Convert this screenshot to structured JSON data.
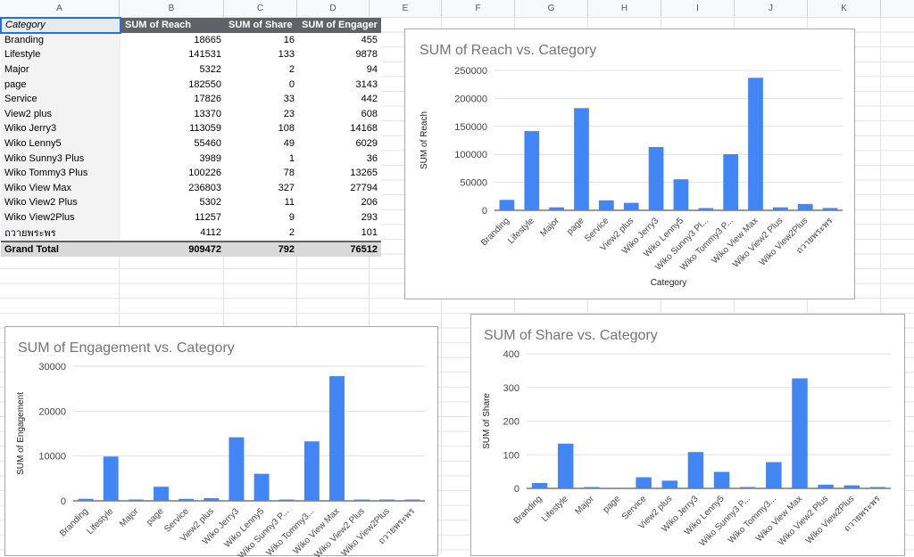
{
  "columns": [
    "A",
    "B",
    "C",
    "D",
    "E",
    "F",
    "G",
    "H",
    "I",
    "J",
    "K"
  ],
  "table": {
    "headers": [
      "Category",
      "SUM of Reach",
      "SUM of Share",
      "SUM of Engager"
    ],
    "rows": [
      {
        "category": "Branding",
        "reach": "18665",
        "share": "16",
        "engagement": "455"
      },
      {
        "category": "Lifestyle",
        "reach": "141531",
        "share": "133",
        "engagement": "9878"
      },
      {
        "category": "Major",
        "reach": "5322",
        "share": "2",
        "engagement": "94"
      },
      {
        "category": "page",
        "reach": "182550",
        "share": "0",
        "engagement": "3143"
      },
      {
        "category": "Service",
        "reach": "17826",
        "share": "33",
        "engagement": "442"
      },
      {
        "category": "View2 plus",
        "reach": "13370",
        "share": "23",
        "engagement": "608"
      },
      {
        "category": "Wiko Jerry3",
        "reach": "113059",
        "share": "108",
        "engagement": "14168"
      },
      {
        "category": "Wiko Lenny5",
        "reach": "55460",
        "share": "49",
        "engagement": "6029"
      },
      {
        "category": "Wiko Sunny3 Plus",
        "reach": "3989",
        "share": "1",
        "engagement": "36"
      },
      {
        "category": "Wiko Tommy3 Plus",
        "reach": "100226",
        "share": "78",
        "engagement": "13265"
      },
      {
        "category": "Wiko View Max",
        "reach": "236803",
        "share": "327",
        "engagement": "27794"
      },
      {
        "category": "Wiko View2 Plus",
        "reach": "5302",
        "share": "11",
        "engagement": "206"
      },
      {
        "category": "Wiko View2Plus",
        "reach": "11257",
        "share": "9",
        "engagement": "293"
      },
      {
        "category": "ถวายพระพร",
        "reach": "4112",
        "share": "2",
        "engagement": "101"
      }
    ],
    "total": {
      "category": "Grand Total",
      "reach": "909472",
      "share": "792",
      "engagement": "76512"
    }
  },
  "chart_data": [
    {
      "type": "bar",
      "title": "SUM of Reach vs. Category",
      "xlabel": "Category",
      "ylabel": "SUM of Reach",
      "ylim": [
        0,
        250000
      ],
      "yticks": [
        "0",
        "50000",
        "100000",
        "150000",
        "200000",
        "250000"
      ],
      "categories": [
        "Branding",
        "Lifestyle",
        "Major",
        "page",
        "Service",
        "View2 plus",
        "Wiko Jerry3",
        "Wiko Lenny5",
        "Wiko Sunny3 Pl...",
        "Wiko Tommy3 P...",
        "Wiko View Max",
        "Wiko View2 Plus",
        "Wiko View2Plus",
        "ถวายพระพร"
      ],
      "values": [
        18665,
        141531,
        5322,
        182550,
        17826,
        13370,
        113059,
        55460,
        3989,
        100226,
        236803,
        5302,
        11257,
        4112
      ],
      "color": "#4285f4",
      "grid": true
    },
    {
      "type": "bar",
      "title": "SUM of Engagement vs. Category",
      "xlabel": "",
      "ylabel": "SUM of Engagement",
      "ylim": [
        0,
        30000
      ],
      "yticks": [
        "0",
        "10000",
        "20000",
        "30000"
      ],
      "categories": [
        "Branding",
        "Lifestyle",
        "Major",
        "page",
        "Service",
        "View2 plus",
        "Wiko Jerry3",
        "Wiko Lenny5",
        "Wiko Sunny3 P...",
        "Wiko Tommy3...",
        "Wiko View Max",
        "Wiko View2 Plus",
        "Wiko View2Plus",
        "ถวายพระพร"
      ],
      "values": [
        455,
        9878,
        94,
        3143,
        442,
        608,
        14168,
        6029,
        36,
        13265,
        27794,
        206,
        293,
        101
      ],
      "color": "#4285f4",
      "grid": true
    },
    {
      "type": "bar",
      "title": "SUM of Share vs. Category",
      "xlabel": "",
      "ylabel": "SUM of Share",
      "ylim": [
        0,
        400
      ],
      "yticks": [
        "0",
        "100",
        "200",
        "300",
        "400"
      ],
      "categories": [
        "Branding",
        "Lifestyle",
        "Major",
        "page",
        "Service",
        "View2 plus",
        "Wiko Jerry3",
        "Wiko Lenny5",
        "Wiko Sunny3 P...",
        "Wiko Tommy3...",
        "Wiko View Max",
        "Wiko View2 Plus",
        "Wiko View2Plus",
        "ถวายพระพร"
      ],
      "values": [
        16,
        133,
        2,
        0,
        33,
        23,
        108,
        49,
        1,
        78,
        327,
        11,
        9,
        2
      ],
      "color": "#4285f4",
      "grid": true
    }
  ]
}
